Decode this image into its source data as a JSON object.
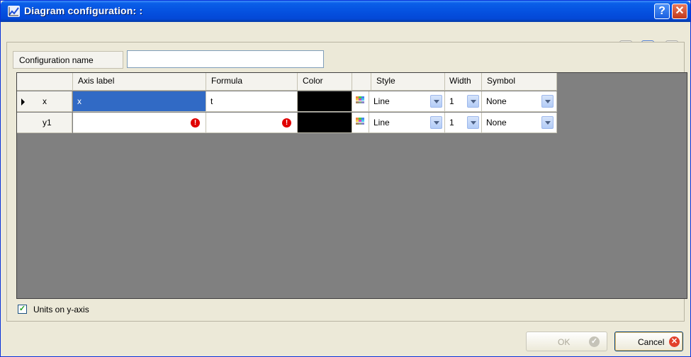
{
  "window": {
    "title": "Diagram configuration: :",
    "help_glyph": "?",
    "close_glyph": "✕"
  },
  "toolbar": {
    "icons": [
      "print-icon",
      "load-config-icon",
      "save-icon"
    ]
  },
  "config": {
    "label": "Configuration name",
    "value": ""
  },
  "grid": {
    "headers": {
      "axis_label": "Axis label",
      "formula": "Formula",
      "color": "Color",
      "style": "Style",
      "width": "Width",
      "symbol": "Symbol"
    },
    "rows": [
      {
        "name": "x",
        "axis_label": "x",
        "formula": "t",
        "color": "#000000",
        "style": "Line",
        "width": "1",
        "symbol": "None",
        "selected": true,
        "error": false
      },
      {
        "name": "y1",
        "axis_label": "",
        "formula": "",
        "color": "#000000",
        "style": "Line",
        "width": "1",
        "symbol": "None",
        "selected": false,
        "error": true
      }
    ]
  },
  "options": {
    "units_on_y_axis_label": "Units on y-axis",
    "units_on_y_axis_checked": true
  },
  "buttons": {
    "ok_label": "OK",
    "cancel_label": "Cancel"
  },
  "colors": {
    "title_blue": "#0551e0",
    "selection": "#316ac5",
    "error_red": "#e00000",
    "grid_background": "#808080"
  }
}
